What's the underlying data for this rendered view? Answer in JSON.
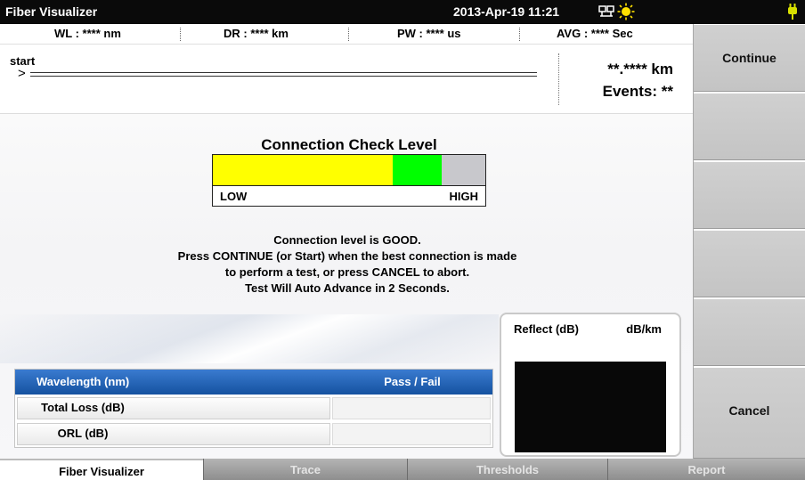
{
  "titlebar": {
    "app_title": "Fiber Visualizer",
    "datetime": "2013-Apr-19 11:21",
    "icons": [
      "network-icon",
      "sun-icon",
      "power-plug-icon"
    ]
  },
  "params": {
    "wl": "WL : **** nm",
    "dr": "DR : **** km",
    "pw": "PW : **** us",
    "avg": "AVG : **** Sec"
  },
  "fiber": {
    "start_label": "start",
    "start_arrow": ">",
    "distance": "**.**** km",
    "events": "Events: **"
  },
  "connection_check": {
    "title": "Connection Check Level",
    "low_label": "LOW",
    "high_label": "HIGH",
    "level": 0.84,
    "colors": {
      "yellow": "#ffff00",
      "green": "#00ff00",
      "gray": "#c8c8cc"
    }
  },
  "message": {
    "line1": "Connection level is GOOD.",
    "line2": "Press CONTINUE (or Start) when the best connection is made",
    "line3": "to perform a test, or press CANCEL to abort.",
    "line4": "Test Will Auto Advance in 2 Seconds."
  },
  "results": {
    "header_col1": "Wavelength (nm)",
    "header_col2": "Pass / Fail",
    "rows": [
      {
        "label": "Total Loss (dB)"
      },
      {
        "label": "ORL (dB)"
      }
    ]
  },
  "reflect": {
    "label1": "Reflect (dB)",
    "label2": "dB/km"
  },
  "side_buttons": [
    "Continue",
    "",
    "",
    "",
    "",
    "Cancel"
  ],
  "tabs": [
    "Fiber Visualizer",
    "Trace",
    "Thresholds",
    "Report"
  ],
  "accent_blue": "#1e5fb4"
}
